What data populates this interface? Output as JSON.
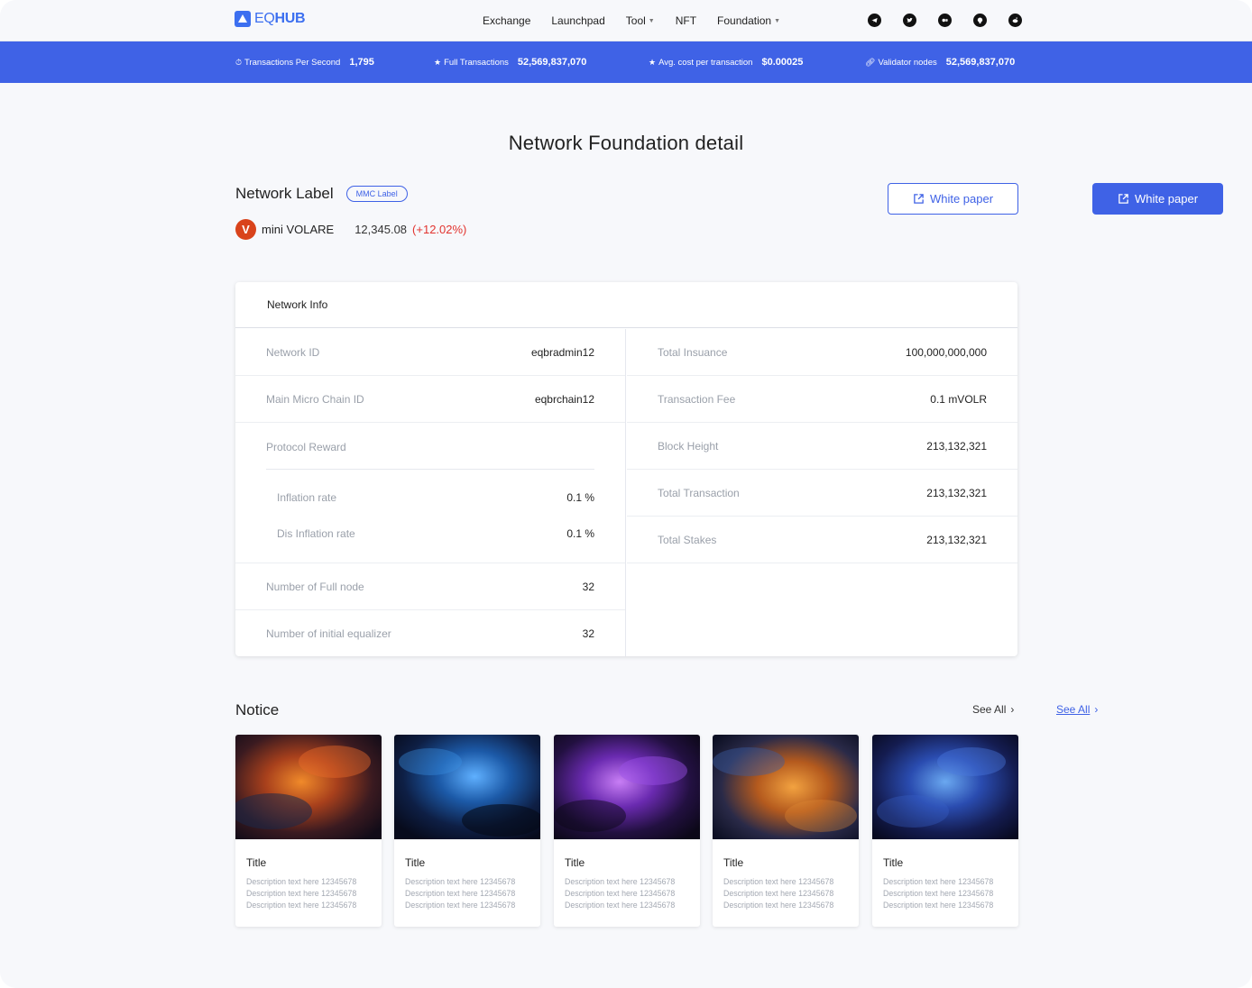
{
  "header": {
    "logo": {
      "prefix": "EQ",
      "suffix": "HUB"
    },
    "nav": [
      {
        "label": "Exchange",
        "dropdown": false
      },
      {
        "label": "Launchpad",
        "dropdown": false
      },
      {
        "label": "Tool",
        "dropdown": true
      },
      {
        "label": "NFT",
        "dropdown": false
      },
      {
        "label": "Foundation",
        "dropdown": true
      }
    ],
    "socials": [
      "telegram-icon",
      "twitter-icon",
      "medium-icon",
      "github-icon",
      "reddit-icon"
    ]
  },
  "stats": [
    {
      "label": "Transactions Per Second",
      "value": "1,795",
      "icon": "clock-icon"
    },
    {
      "label": "Full Transactions",
      "value": "52,569,837,070",
      "icon": "star-icon"
    },
    {
      "label": "Avg. cost per transaction",
      "value": "$0.00025",
      "icon": "star-icon"
    },
    {
      "label": "Validator nodes",
      "value": "52,569,837,070",
      "icon": "link-icon"
    }
  ],
  "page": {
    "title": "Network Foundation detail",
    "network_label": "Network Label",
    "pill": "MMC Label",
    "token": {
      "logo_letter": "V",
      "name": "mini VOLARE",
      "price": "12,345.08",
      "change": "(+12.02%)"
    },
    "white_paper_outline": "White paper",
    "white_paper_filled": "White paper"
  },
  "network_info": {
    "title": "Network Info",
    "left": {
      "network_id": {
        "k": "Network ID",
        "v": "eqbradmin12"
      },
      "main_chain": {
        "k": "Main Micro Chain ID",
        "v": "eqbrchain12"
      },
      "protocol_reward": "Protocol Reward",
      "inflation": {
        "k": "Inflation rate",
        "v": "0.1 %"
      },
      "dis_inflation": {
        "k": "Dis Inflation rate",
        "v": "0.1 %"
      },
      "full_node": {
        "k": "Number of Full node",
        "v": "32"
      },
      "initial_eq": {
        "k": "Number of initial equalizer",
        "v": "32"
      }
    },
    "right": [
      {
        "k": "Total Insuance",
        "v": "100,000,000,000"
      },
      {
        "k": "Transaction Fee",
        "v": "0.1 mVOLR"
      },
      {
        "k": "Block Height",
        "v": "213,132,321"
      },
      {
        "k": "Total Transaction",
        "v": "213,132,321"
      },
      {
        "k": "Total Stakes",
        "v": "213,132,321"
      }
    ]
  },
  "notice": {
    "title": "Notice",
    "see_all_1": "See All",
    "see_all_2": "See All",
    "cards": [
      {
        "title": "Title",
        "desc": [
          "Description text here 12345678",
          "Description text here 12345678",
          "Description text here 12345678"
        ],
        "palette": "orange-nebula"
      },
      {
        "title": "Title",
        "desc": [
          "Description text here 12345678",
          "Description text here 12345678",
          "Description text here 12345678"
        ],
        "palette": "blue-nebula"
      },
      {
        "title": "Title",
        "desc": [
          "Description text here 12345678",
          "Description text here 12345678",
          "Description text here 12345678"
        ],
        "palette": "purple-nebula"
      },
      {
        "title": "Title",
        "desc": [
          "Description text here 12345678",
          "Description text here 12345678",
          "Description text here 12345678"
        ],
        "palette": "amber-nebula"
      },
      {
        "title": "Title",
        "desc": [
          "Description text here 12345678",
          "Description text here 12345678",
          "Description text here 12345678"
        ],
        "palette": "deep-blue-nebula"
      }
    ]
  },
  "colors": {
    "accent": "#3f62e6",
    "negative": "#e2342f",
    "token": "#d9431b"
  }
}
